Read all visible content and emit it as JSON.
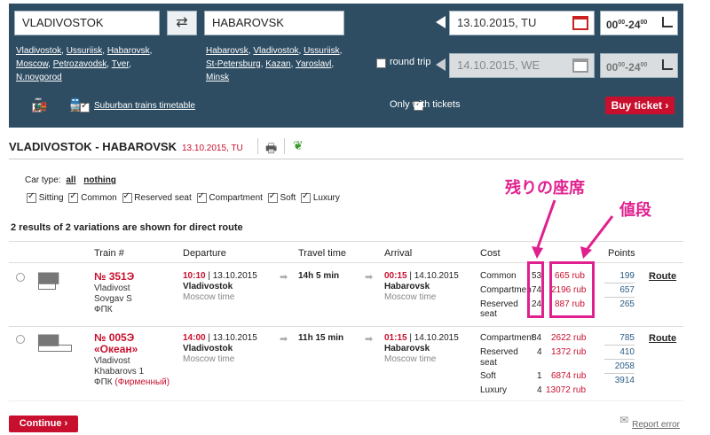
{
  "search": {
    "from_value": "VLADIVOSTOK",
    "to_value": "HABAROVSK",
    "from_links": [
      "Vladivostok",
      "Ussuriisk",
      "Habarovsk",
      "Moscow",
      "Petrozavodsk",
      "Tver",
      "N.novgorod"
    ],
    "to_links": [
      "Habarovsk",
      "Vladivostok",
      "Ussuriisk",
      "St-Petersburg",
      "Kazan",
      "Yaroslavl",
      "Minsk"
    ],
    "date_there": "13.10.2015, TU",
    "date_back": "14.10.2015, WE",
    "time_range": "00",
    "time_sup1": "00",
    "time_dash": "-24",
    "time_sup2": "00",
    "round_trip_label": "round trip",
    "only_with_tickets_label": "Only with tickets",
    "suburban_link": "Suburban trains timetable",
    "buy_ticket": "Buy ticket"
  },
  "results": {
    "route_title": "VLADIVOSTOK - HABAROVSK",
    "route_date": "13.10.2015, TU",
    "car_type_label": "Car type:",
    "car_type_all": "all",
    "car_type_nothing": "nothing",
    "car_types": [
      "Sitting",
      "Common",
      "Reserved seat",
      "Compartment",
      "Soft",
      "Luxury"
    ],
    "summary": "2 results of 2 variations are shown for direct route",
    "columns": [
      "Train #",
      "Departure",
      "Travel time",
      "Arrival",
      "Cost",
      "Points"
    ],
    "trains": [
      {
        "number": "№ 351Э",
        "name": "",
        "from": "Vladivost",
        "to": "Sovgav S",
        "carrier": "ФПК",
        "carrier_extra": "",
        "dep_time": "10:10",
        "dep_date": "13.10.2015",
        "dep_station": "Vladivostok",
        "dep_tz": "Moscow time",
        "travel": "14h 5 min",
        "arr_time": "00:15",
        "arr_date": "14.10.2015",
        "arr_station": "Habarovsk",
        "arr_tz": "Moscow time",
        "costs": [
          {
            "type": "Common",
            "seats": "53",
            "price": "665 rub",
            "points": "199"
          },
          {
            "type": "Compartment",
            "seats": "74",
            "price": "2196 rub",
            "points": "657"
          },
          {
            "type": "Reserved seat",
            "seats": "24",
            "price": "887 rub",
            "points": "265"
          }
        ],
        "route": "Route"
      },
      {
        "number": "№ 005Э",
        "name": "«Океан»",
        "from": "Vladivost",
        "to": "Khabarovs 1",
        "carrier": "ФПК",
        "carrier_extra": "(Фирменный)",
        "dep_time": "14:00",
        "dep_date": "13.10.2015",
        "dep_station": "Vladivostok",
        "dep_tz": "Moscow time",
        "travel": "11h 15 min",
        "arr_time": "01:15",
        "arr_date": "14.10.2015",
        "arr_station": "Habarovsk",
        "arr_tz": "Moscow time",
        "costs": [
          {
            "type": "Compartment",
            "seats": "84",
            "price": "2622 rub",
            "points": "785"
          },
          {
            "type": "Reserved seat",
            "seats": "4",
            "price": "1372 rub",
            "points": "410"
          },
          {
            "type": "Soft",
            "seats": "1",
            "price": "6874 rub",
            "points": "2058"
          },
          {
            "type": "Luxury",
            "seats": "4",
            "price": "13072 rub",
            "points": "3914"
          }
        ],
        "route": "Route"
      }
    ],
    "continue": "Continue",
    "report_error": "Report error"
  },
  "annotations": {
    "seats_label": "残りの座席",
    "price_label": "値段"
  },
  "colors": {
    "panel": "#2e4d63",
    "accent_red": "#c8102e",
    "annotation": "#e0208e"
  }
}
